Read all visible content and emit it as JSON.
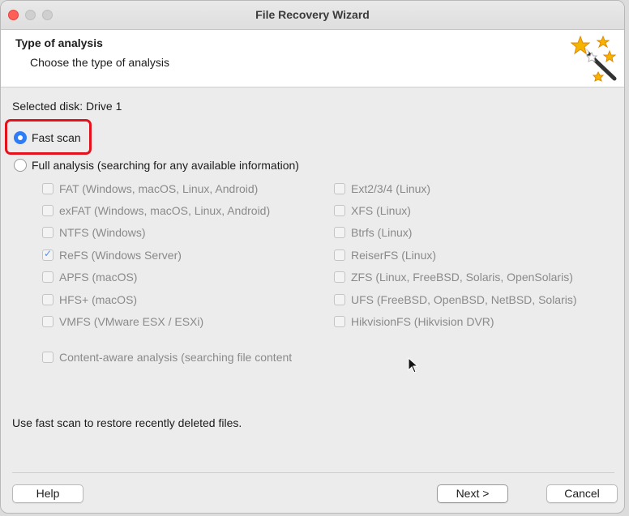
{
  "window": {
    "title": "File Recovery Wizard"
  },
  "header": {
    "title": "Type of analysis",
    "subtitle": "Choose the type of analysis",
    "icon": "magic-wand-icon"
  },
  "selected_disk": "Selected disk: Drive 1",
  "scan_options": [
    {
      "label": "Fast scan",
      "checked": true
    },
    {
      "label": "Full analysis (searching for any available information)",
      "checked": false
    }
  ],
  "filesystems_left": [
    {
      "label": "FAT (Windows, macOS, Linux, Android)",
      "checked": false
    },
    {
      "label": "exFAT (Windows, macOS, Linux, Android)",
      "checked": false
    },
    {
      "label": "NTFS (Windows)",
      "checked": false
    },
    {
      "label": "ReFS (Windows Server)",
      "checked": true
    },
    {
      "label": "APFS (macOS)",
      "checked": false
    },
    {
      "label": "HFS+ (macOS)",
      "checked": false
    },
    {
      "label": "VMFS (VMware ESX / ESXi)",
      "checked": false
    }
  ],
  "filesystems_right": [
    {
      "label": "Ext2/3/4 (Linux)",
      "checked": false
    },
    {
      "label": "XFS (Linux)",
      "checked": false
    },
    {
      "label": "Btrfs (Linux)",
      "checked": false
    },
    {
      "label": "ReiserFS (Linux)",
      "checked": false
    },
    {
      "label": "ZFS (Linux, FreeBSD, Solaris, OpenSolaris)",
      "checked": false
    },
    {
      "label": "UFS (FreeBSD, OpenBSD, NetBSD, Solaris)",
      "checked": false
    },
    {
      "label": "HikvisionFS (Hikvision DVR)",
      "checked": false
    }
  ],
  "content_aware": {
    "label": "Content-aware analysis (searching file content",
    "checked": false
  },
  "info_text": "Use fast scan to restore recently deleted files.",
  "buttons": {
    "help": "Help",
    "next": "Next >",
    "cancel": "Cancel"
  },
  "colors": {
    "highlight": "#e3121d",
    "radio_accent": "#2f7df6"
  }
}
